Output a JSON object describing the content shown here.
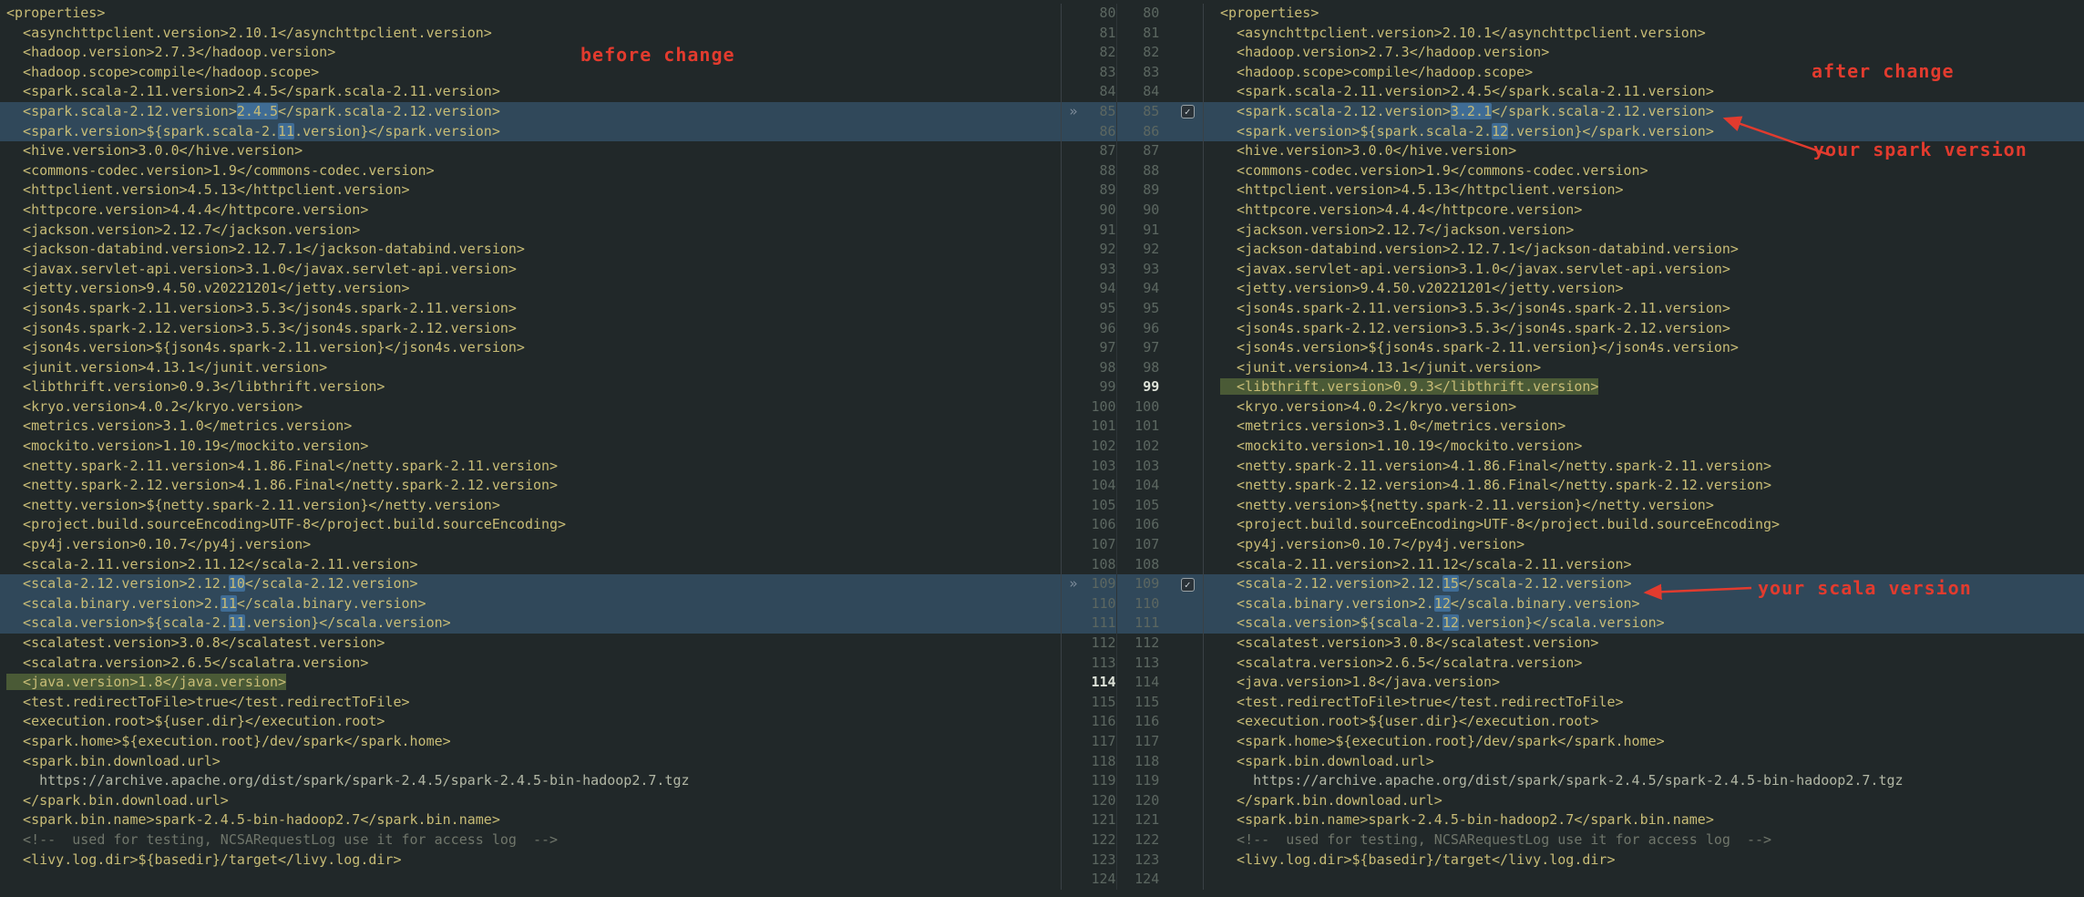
{
  "colors": {
    "bg": "#212829",
    "band": "#30485a",
    "frag": "#3f6c95",
    "green": "#4a5a36",
    "text": "#c8bc76",
    "plain": "#b2b7a5",
    "comment": "#70766b",
    "lnum": "#5c6761",
    "lnumBold": "#dde2d8",
    "chev": "#7d8b99",
    "border": "#3a4146",
    "borderSoft": "#2e3539",
    "cbBorder": "#99a2a6",
    "cbCheck": "#ccd3d6",
    "cbBg": "#2a3238",
    "red": "#e23b2e"
  },
  "annotations": {
    "before": "before change",
    "after": "after change",
    "spark": "your spark version",
    "scala": "your scala version"
  },
  "diff": {
    "chevron_glyph": "»",
    "checkbox_glyph": "✓",
    "rows": [
      {
        "n": 80,
        "t": "<properties>"
      },
      {
        "n": 81,
        "t": "  <asynchttpclient.version>2.10.1</asynchttpclient.version>"
      },
      {
        "n": 82,
        "t": "  <hadoop.version>2.7.3</hadoop.version>"
      },
      {
        "n": 83,
        "t": "  <hadoop.scope>compile</hadoop.scope>"
      },
      {
        "n": 84,
        "t": "  <spark.scala-2.11.version>2.4.5</spark.scala-2.11.version>"
      },
      {
        "n": 85,
        "c": true,
        "first": true,
        "l": [
          "  <spark.scala-2.12.version>",
          {
            "f": "2.4.5"
          },
          "</spark.scala-2.12.version>"
        ],
        "r": [
          "  <spark.scala-2.12.version>",
          {
            "f": "3.2.1"
          },
          "</spark.scala-2.12.version>"
        ]
      },
      {
        "n": 86,
        "c": true,
        "l": [
          "  <spark.version>${spark.scala-2.",
          {
            "f": "11"
          },
          ".version}</spark.version>"
        ],
        "r": [
          "  <spark.version>${spark.scala-2.",
          {
            "f": "12"
          },
          ".version}</spark.version>"
        ]
      },
      {
        "n": 87,
        "t": "  <hive.version>3.0.0</hive.version>"
      },
      {
        "n": 88,
        "t": "  <commons-codec.version>1.9</commons-codec.version>"
      },
      {
        "n": 89,
        "t": "  <httpclient.version>4.5.13</httpclient.version>"
      },
      {
        "n": 90,
        "t": "  <httpcore.version>4.4.4</httpcore.version>"
      },
      {
        "n": 91,
        "t": "  <jackson.version>2.12.7</jackson.version>"
      },
      {
        "n": 92,
        "t": "  <jackson-databind.version>2.12.7.1</jackson-databind.version>"
      },
      {
        "n": 93,
        "t": "  <javax.servlet-api.version>3.1.0</javax.servlet-api.version>"
      },
      {
        "n": 94,
        "t": "  <jetty.version>9.4.50.v20221201</jetty.version>"
      },
      {
        "n": 95,
        "t": "  <json4s.spark-2.11.version>3.5.3</json4s.spark-2.11.version>"
      },
      {
        "n": 96,
        "t": "  <json4s.spark-2.12.version>3.5.3</json4s.spark-2.12.version>"
      },
      {
        "n": 97,
        "t": "  <json4s.version>${json4s.spark-2.11.version}</json4s.version>"
      },
      {
        "n": 98,
        "t": "  <junit.version>4.13.1</junit.version>"
      },
      {
        "n": 99,
        "t": "  <libthrift.version>0.9.3</libthrift.version>",
        "g": "right",
        "boldR": true
      },
      {
        "n": 100,
        "t": "  <kryo.version>4.0.2</kryo.version>"
      },
      {
        "n": 101,
        "t": "  <metrics.version>3.1.0</metrics.version>"
      },
      {
        "n": 102,
        "t": "  <mockito.version>1.10.19</mockito.version>"
      },
      {
        "n": 103,
        "t": "  <netty.spark-2.11.version>4.1.86.Final</netty.spark-2.11.version>"
      },
      {
        "n": 104,
        "t": "  <netty.spark-2.12.version>4.1.86.Final</netty.spark-2.12.version>"
      },
      {
        "n": 105,
        "t": "  <netty.version>${netty.spark-2.11.version}</netty.version>"
      },
      {
        "n": 106,
        "t": "  <project.build.sourceEncoding>UTF-8</project.build.sourceEncoding>"
      },
      {
        "n": 107,
        "t": "  <py4j.version>0.10.7</py4j.version>"
      },
      {
        "n": 108,
        "t": "  <scala-2.11.version>2.11.12</scala-2.11.version>"
      },
      {
        "n": 109,
        "c": true,
        "first": true,
        "l": [
          "  <scala-2.12.version>2.12.",
          {
            "f": "10"
          },
          "</scala-2.12.version>"
        ],
        "r": [
          "  <scala-2.12.version>2.12.",
          {
            "f": "15"
          },
          "</scala-2.12.version>"
        ]
      },
      {
        "n": 110,
        "c": true,
        "l": [
          "  <scala.binary.version>2.",
          {
            "f": "11"
          },
          "</scala.binary.version>"
        ],
        "r": [
          "  <scala.binary.version>2.",
          {
            "f": "12"
          },
          "</scala.binary.version>"
        ]
      },
      {
        "n": 111,
        "c": true,
        "l": [
          "  <scala.version>${scala-2.",
          {
            "f": "11"
          },
          ".version}</scala.version>"
        ],
        "r": [
          "  <scala.version>${scala-2.",
          {
            "f": "12"
          },
          ".version}</scala.version>"
        ]
      },
      {
        "n": 112,
        "t": "  <scalatest.version>3.0.8</scalatest.version>"
      },
      {
        "n": 113,
        "t": "  <scalatra.version>2.6.5</scalatra.version>"
      },
      {
        "n": 114,
        "t": "  <java.version>1.8</java.version>",
        "g": "left",
        "boldL": true
      },
      {
        "n": 115,
        "t": "  <test.redirectToFile>true</test.redirectToFile>"
      },
      {
        "n": 116,
        "t": "  <execution.root>${user.dir}</execution.root>"
      },
      {
        "n": 117,
        "t": "  <spark.home>${execution.root}/dev/spark</spark.home>"
      },
      {
        "n": 118,
        "t": "  <spark.bin.download.url>"
      },
      {
        "n": 119,
        "t": "    https://archive.apache.org/dist/spark/spark-2.4.5/spark-2.4.5-bin-hadoop2.7.tgz",
        "cls": "plain"
      },
      {
        "n": 120,
        "t": "  </spark.bin.download.url>"
      },
      {
        "n": 121,
        "t": "  <spark.bin.name>spark-2.4.5-bin-hadoop2.7</spark.bin.name>"
      },
      {
        "n": 122,
        "t": "  <!--  used for testing, NCSARequestLog use it for access log  -->",
        "cls": "comment"
      },
      {
        "n": 123,
        "t": "  <livy.log.dir>${basedir}/target</livy.log.dir>"
      },
      {
        "n": 124,
        "t": ""
      }
    ]
  }
}
